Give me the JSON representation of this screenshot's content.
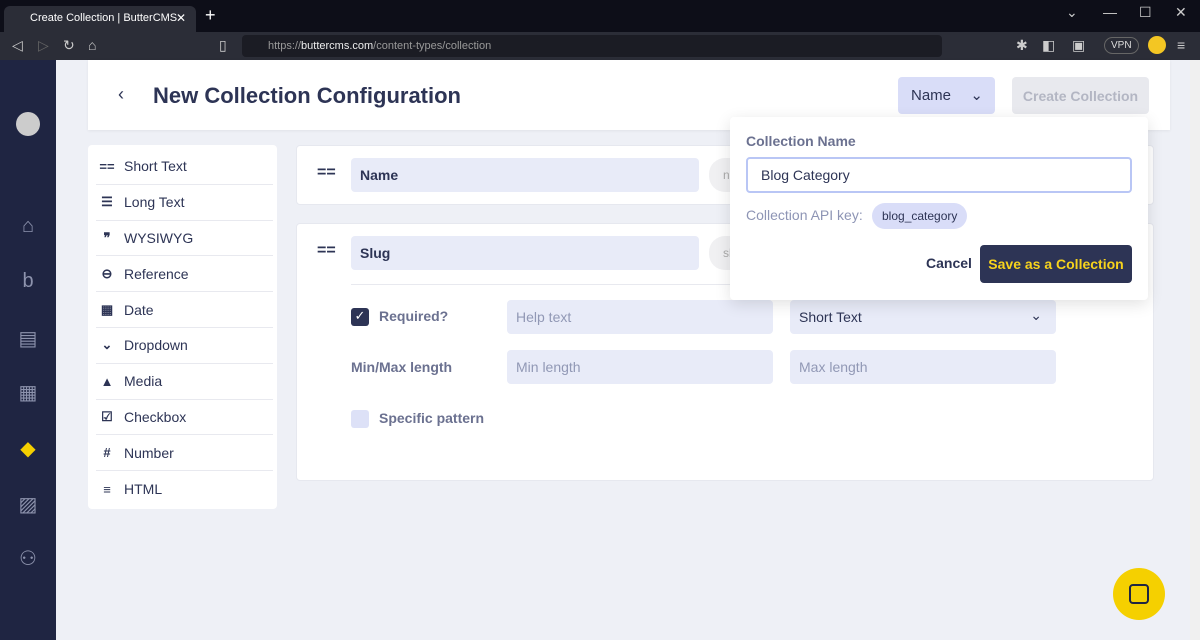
{
  "browser": {
    "tab_title": "Create Collection | ButterCMS",
    "url_prefix": "https://",
    "url_domain": "buttercms.com",
    "url_path": "/content-types/collection",
    "vpn": "VPN"
  },
  "sidebar": {
    "items": [
      "logo",
      "home",
      "blog",
      "pages",
      "page-types",
      "collections",
      "media",
      "users"
    ]
  },
  "header": {
    "title": "New Collection Configuration",
    "name_select": "Name",
    "create_button": "Create Collection"
  },
  "palette": [
    {
      "icon": "==",
      "label": "Short Text"
    },
    {
      "icon": "☰",
      "label": "Long Text"
    },
    {
      "icon": "❞",
      "label": "WYSIWYG"
    },
    {
      "icon": "⊖",
      "label": "Reference"
    },
    {
      "icon": "▦",
      "label": "Date"
    },
    {
      "icon": "⌄",
      "label": "Dropdown"
    },
    {
      "icon": "▲",
      "label": "Media"
    },
    {
      "icon": "☑",
      "label": "Checkbox"
    },
    {
      "icon": "#",
      "label": "Number"
    },
    {
      "icon": "≡",
      "label": "HTML"
    }
  ],
  "fields": {
    "name": {
      "value": "Name",
      "api_chip": "n"
    },
    "slug": {
      "value": "Slug",
      "api_chip": "sl",
      "required_label": "Required?",
      "required": true,
      "help_placeholder": "Help text",
      "type": "Short Text",
      "minmax_label": "Min/Max length",
      "min_placeholder": "Min length",
      "max_placeholder": "Max length",
      "pattern_label": "Specific pattern",
      "pattern": false
    }
  },
  "popover": {
    "label": "Collection Name",
    "value": "Blog Category",
    "api_key_label": "Collection API key:",
    "api_key": "blog_category",
    "cancel": "Cancel",
    "save": "Save as a Collection"
  },
  "colors": {
    "navy": "#2d3455",
    "accent_yellow": "#f5d000",
    "input_bg": "#e8ebf8"
  }
}
